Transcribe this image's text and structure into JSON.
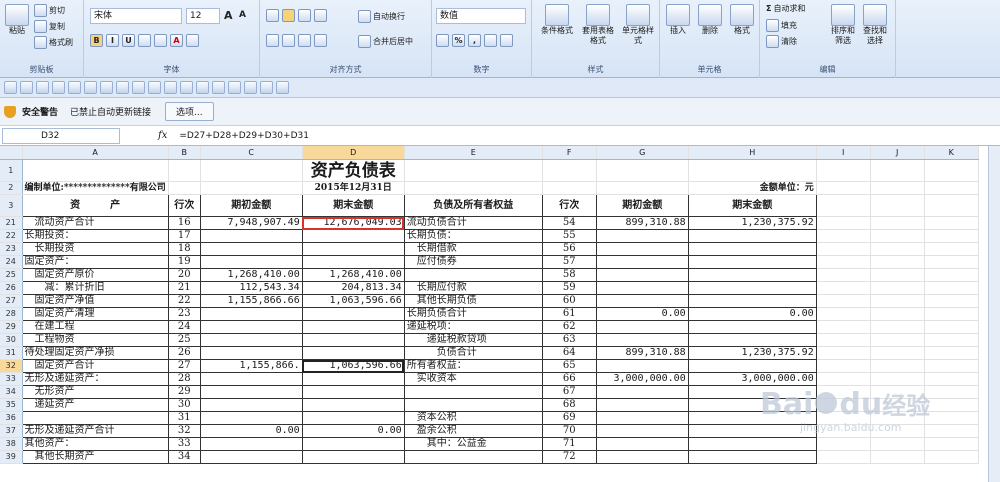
{
  "ribbon": {
    "clipboard": {
      "paste": "粘贴",
      "cut": "剪切",
      "copy": "复制",
      "format_painter": "格式刷",
      "label": "剪贴板"
    },
    "font": {
      "name": "宋体",
      "size": "12",
      "label": "字体",
      "grow": "A",
      "shrink": "A"
    },
    "alignment": {
      "wrap": "自动换行",
      "merge": "合并后居中",
      "label": "对齐方式"
    },
    "number": {
      "format": "数值",
      "label": "数字"
    },
    "styles": {
      "conditional": "条件格式",
      "table": "套用表格格式",
      "cell": "单元格样式",
      "label": "样式"
    },
    "cells": {
      "insert": "插入",
      "delete": "删除",
      "format": "格式",
      "label": "单元格"
    },
    "editing": {
      "autosum": "自动求和",
      "fill": "填充",
      "clear": "清除",
      "sort": "排序和筛选",
      "find": "查找和选择",
      "label": "编辑"
    }
  },
  "security": {
    "title": "安全警告",
    "message": "已禁止自动更新链接",
    "options": "选项..."
  },
  "formula_bar": {
    "namebox": "D32",
    "fx": "fx",
    "formula": "=D27+D28+D29+D30+D31"
  },
  "columns": [
    "A",
    "B",
    "C",
    "D",
    "E",
    "F",
    "G",
    "H",
    "I",
    "J",
    "K"
  ],
  "rows": [
    {
      "n": "1",
      "a": "",
      "b": "",
      "c": "",
      "d": "资产负债表",
      "e": "",
      "f": "",
      "g": "",
      "h": ""
    },
    {
      "n": "2",
      "a": "编制单位:**************有限公司",
      "b": "",
      "c": "",
      "d": "2015年12月31日",
      "e": "",
      "f": "",
      "g": "",
      "h": "金额单位：元"
    },
    {
      "n": "3",
      "a": "资　　　产",
      "b": "行次",
      "c": "期初金额",
      "d": "期末金额",
      "e": "负债及所有者权益",
      "f": "行次",
      "g": "期初金额",
      "h": "期末金额"
    },
    {
      "n": "21",
      "a": "　流动资产合计",
      "b": "16",
      "c": "7,948,907.49",
      "d": "12,676,049.03",
      "e": "流动负债合计",
      "f": "54",
      "g": "899,310.88",
      "h": "1,230,375.92"
    },
    {
      "n": "22",
      "a": "长期投资：",
      "b": "17",
      "c": "",
      "d": "",
      "e": "长期负债：",
      "f": "55",
      "g": "",
      "h": ""
    },
    {
      "n": "23",
      "a": "　长期投资",
      "b": "18",
      "c": "",
      "d": "",
      "e": "　长期借款",
      "f": "56",
      "g": "",
      "h": ""
    },
    {
      "n": "24",
      "a": "固定资产：",
      "b": "19",
      "c": "",
      "d": "",
      "e": "　应付债券",
      "f": "57",
      "g": "",
      "h": ""
    },
    {
      "n": "25",
      "a": "　固定资产原价",
      "b": "20",
      "c": "1,268,410.00",
      "d": "1,268,410.00",
      "e": "",
      "f": "58",
      "g": "",
      "h": ""
    },
    {
      "n": "26",
      "a": "　　减：累计折旧",
      "b": "21",
      "c": "112,543.34",
      "d": "204,813.34",
      "e": "　长期应付款",
      "f": "59",
      "g": "",
      "h": ""
    },
    {
      "n": "27",
      "a": "　固定资产净值",
      "b": "22",
      "c": "1,155,866.66",
      "d": "1,063,596.66",
      "e": "　其他长期负债",
      "f": "60",
      "g": "",
      "h": ""
    },
    {
      "n": "28",
      "a": "　固定资产清理",
      "b": "23",
      "c": "",
      "d": "",
      "e": "长期负债合计",
      "f": "61",
      "g": "0.00",
      "h": "0.00"
    },
    {
      "n": "29",
      "a": "　在建工程",
      "b": "24",
      "c": "",
      "d": "",
      "e": "递延税项：",
      "f": "62",
      "g": "",
      "h": ""
    },
    {
      "n": "30",
      "a": "　工程物资",
      "b": "25",
      "c": "",
      "d": "",
      "e": "　　递延税款贷项",
      "f": "63",
      "g": "",
      "h": ""
    },
    {
      "n": "31",
      "a": "待处理固定资产净损",
      "b": "26",
      "c": "",
      "d": "",
      "e": "　　　负债合计",
      "f": "64",
      "g": "899,310.88",
      "h": "1,230,375.92"
    },
    {
      "n": "32",
      "a": "　固定资产合计",
      "b": "27",
      "c": "1,155,866.",
      "d": "1,063,596.66",
      "e": "所有者权益：",
      "f": "65",
      "g": "",
      "h": ""
    },
    {
      "n": "33",
      "a": "无形及递延资产：",
      "b": "28",
      "c": "",
      "d": "",
      "e": "　实收资本",
      "f": "66",
      "g": "3,000,000.00",
      "h": "3,000,000.00"
    },
    {
      "n": "34",
      "a": "　无形资产",
      "b": "29",
      "c": "",
      "d": "",
      "e": "",
      "f": "67",
      "g": "",
      "h": ""
    },
    {
      "n": "35",
      "a": "　递延资产",
      "b": "30",
      "c": "",
      "d": "",
      "e": "",
      "f": "68",
      "g": "",
      "h": ""
    },
    {
      "n": "36",
      "a": "",
      "b": "31",
      "c": "",
      "d": "",
      "e": "　资本公积",
      "f": "69",
      "g": "",
      "h": ""
    },
    {
      "n": "37",
      "a": "无形及递延资产合计",
      "b": "32",
      "c": "0.00",
      "d": "0.00",
      "e": "　盈余公积",
      "f": "70",
      "g": "",
      "h": ""
    },
    {
      "n": "38",
      "a": "其他资产：",
      "b": "33",
      "c": "",
      "d": "",
      "e": "　　其中：公益金",
      "f": "71",
      "g": "",
      "h": ""
    },
    {
      "n": "39",
      "a": "　其他长期资产",
      "b": "34",
      "c": "",
      "d": "",
      "e": "",
      "f": "72",
      "g": "",
      "h": ""
    }
  ],
  "watermark": {
    "brand": "Bai",
    "brand2": "du",
    "cn": "经验",
    "url": "jingyan.baidu.com"
  },
  "colors": {
    "highlight_border": "#d9312b",
    "selected_header": "#f9d99a"
  }
}
